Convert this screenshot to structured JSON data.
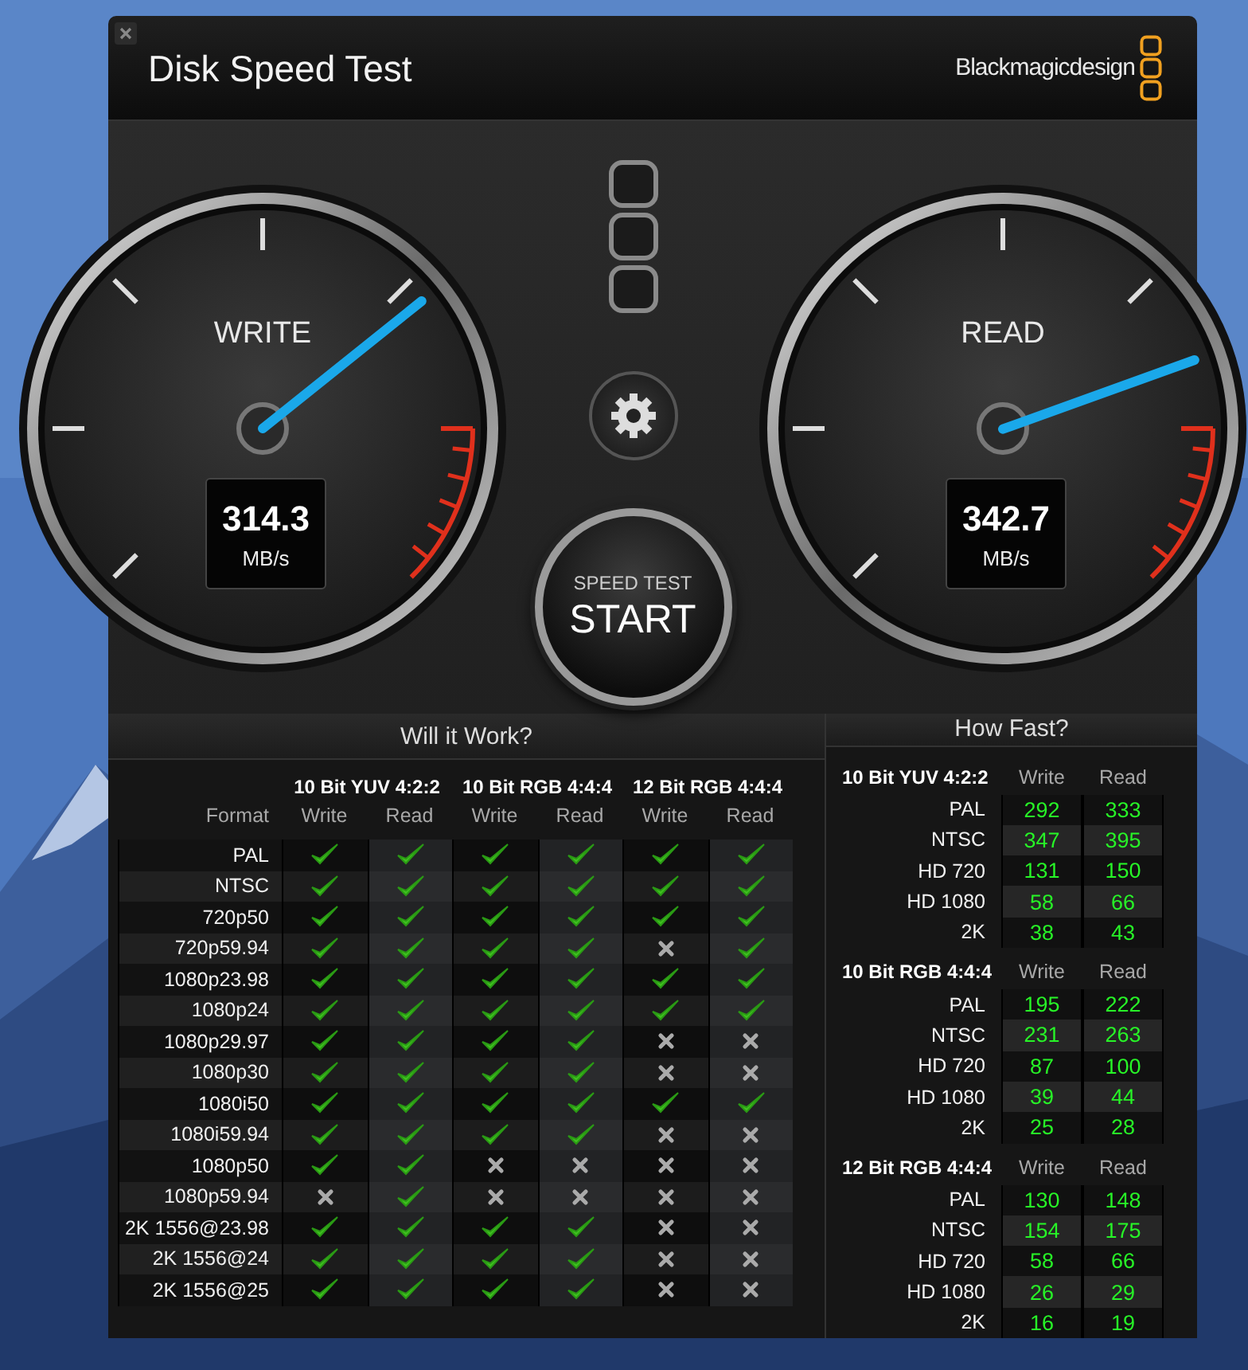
{
  "window": {
    "title": "Disk Speed Test",
    "brand": "Blackmagicdesign"
  },
  "gauges": [
    {
      "label": "WRITE",
      "value": "314.3",
      "unit": "MB/s",
      "level": 0.69
    },
    {
      "label": "READ",
      "value": "342.7",
      "unit": "MB/s",
      "level": 0.76
    }
  ],
  "start_button": {
    "caption": "SPEED TEST",
    "label": "START"
  },
  "will_it_work": {
    "title": "Will it Work?",
    "format_label": "Format",
    "groups": [
      {
        "name": "10 Bit YUV 4:2:2",
        "columns": [
          "Write",
          "Read"
        ]
      },
      {
        "name": "10 Bit RGB 4:4:4",
        "columns": [
          "Write",
          "Read"
        ]
      },
      {
        "name": "12 Bit RGB 4:4:4",
        "columns": [
          "Write",
          "Read"
        ]
      }
    ],
    "rows": [
      {
        "format": "PAL",
        "results": [
          true,
          true,
          true,
          true,
          true,
          true
        ]
      },
      {
        "format": "NTSC",
        "results": [
          true,
          true,
          true,
          true,
          true,
          true
        ]
      },
      {
        "format": "720p50",
        "results": [
          true,
          true,
          true,
          true,
          true,
          true
        ]
      },
      {
        "format": "720p59.94",
        "results": [
          true,
          true,
          true,
          true,
          false,
          true
        ]
      },
      {
        "format": "1080p23.98",
        "results": [
          true,
          true,
          true,
          true,
          true,
          true
        ]
      },
      {
        "format": "1080p24",
        "results": [
          true,
          true,
          true,
          true,
          true,
          true
        ]
      },
      {
        "format": "1080p29.97",
        "results": [
          true,
          true,
          true,
          true,
          false,
          false
        ]
      },
      {
        "format": "1080p30",
        "results": [
          true,
          true,
          true,
          true,
          false,
          false
        ]
      },
      {
        "format": "1080i50",
        "results": [
          true,
          true,
          true,
          true,
          true,
          true
        ]
      },
      {
        "format": "1080i59.94",
        "results": [
          true,
          true,
          true,
          true,
          false,
          false
        ]
      },
      {
        "format": "1080p50",
        "results": [
          true,
          true,
          false,
          false,
          false,
          false
        ]
      },
      {
        "format": "1080p59.94",
        "results": [
          false,
          true,
          false,
          false,
          false,
          false
        ]
      },
      {
        "format": "2K 1556@23.98",
        "results": [
          true,
          true,
          true,
          true,
          false,
          false
        ]
      },
      {
        "format": "2K 1556@24",
        "results": [
          true,
          true,
          true,
          true,
          false,
          false
        ]
      },
      {
        "format": "2K 1556@25",
        "results": [
          true,
          true,
          true,
          true,
          false,
          false
        ]
      }
    ]
  },
  "how_fast": {
    "title": "How Fast?",
    "groups": [
      {
        "name": "10 Bit YUV 4:2:2",
        "columns": [
          "Write",
          "Read"
        ],
        "rows": [
          {
            "format": "PAL",
            "write": "292",
            "read": "333"
          },
          {
            "format": "NTSC",
            "write": "347",
            "read": "395"
          },
          {
            "format": "HD 720",
            "write": "131",
            "read": "150"
          },
          {
            "format": "HD 1080",
            "write": "58",
            "read": "66"
          },
          {
            "format": "2K",
            "write": "38",
            "read": "43"
          }
        ]
      },
      {
        "name": "10 Bit RGB 4:4:4",
        "columns": [
          "Write",
          "Read"
        ],
        "rows": [
          {
            "format": "PAL",
            "write": "195",
            "read": "222"
          },
          {
            "format": "NTSC",
            "write": "231",
            "read": "263"
          },
          {
            "format": "HD 720",
            "write": "87",
            "read": "100"
          },
          {
            "format": "HD 1080",
            "write": "39",
            "read": "44"
          },
          {
            "format": "2K",
            "write": "25",
            "read": "28"
          }
        ]
      },
      {
        "name": "12 Bit RGB 4:4:4",
        "columns": [
          "Write",
          "Read"
        ],
        "rows": [
          {
            "format": "PAL",
            "write": "130",
            "read": "148"
          },
          {
            "format": "NTSC",
            "write": "154",
            "read": "175"
          },
          {
            "format": "HD 720",
            "write": "58",
            "read": "66"
          },
          {
            "format": "HD 1080",
            "write": "26",
            "read": "29"
          },
          {
            "format": "2K",
            "write": "16",
            "read": "19"
          }
        ]
      }
    ]
  }
}
